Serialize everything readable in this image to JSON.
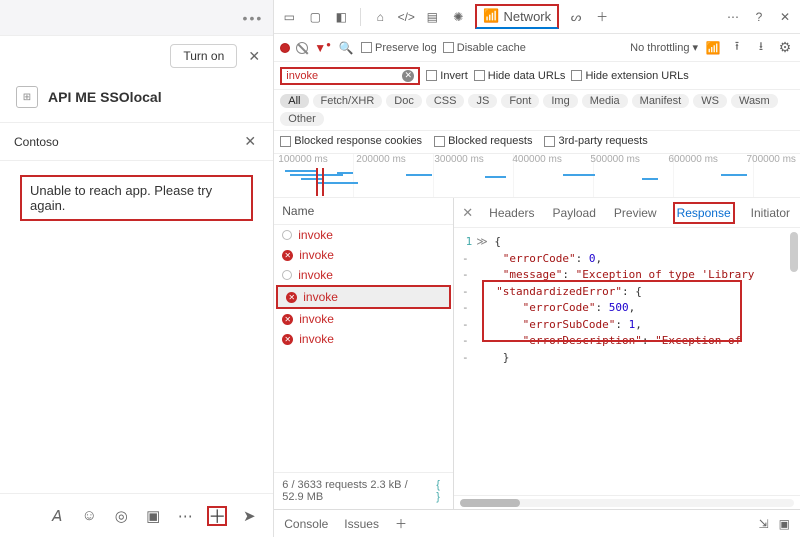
{
  "left": {
    "turn_on": "Turn on",
    "app_title": "API ME SSOlocal",
    "app_icon_glyph": "⊞",
    "card_title": "Contoso",
    "error_message": "Unable to reach app. Please try again."
  },
  "devtools": {
    "tabs": {
      "network_label": "Network"
    },
    "toolbar": {
      "preserve_log": "Preserve log",
      "disable_cache": "Disable cache",
      "throttling": "No throttling"
    },
    "filter": {
      "value": "invoke",
      "invert": "Invert",
      "hide_data_urls": "Hide data URLs",
      "hide_ext_urls": "Hide extension URLs"
    },
    "type_chips": [
      "All",
      "Fetch/XHR",
      "Doc",
      "CSS",
      "JS",
      "Font",
      "Img",
      "Media",
      "Manifest",
      "WS",
      "Wasm",
      "Other"
    ],
    "extra_filters": {
      "blocked_response": "Blocked response cookies",
      "blocked_requests": "Blocked requests",
      "third_party": "3rd-party requests"
    },
    "waterfall_ticks": [
      "100000 ms",
      "200000 ms",
      "300000 ms",
      "400000 ms",
      "500000 ms",
      "600000 ms",
      "700000 ms"
    ],
    "name_header": "Name",
    "requests": [
      {
        "status": "pending",
        "label": "invoke"
      },
      {
        "status": "fail",
        "label": "invoke"
      },
      {
        "status": "pending",
        "label": "invoke"
      },
      {
        "status": "fail",
        "label": "invoke",
        "selected": true,
        "highlight": true
      },
      {
        "status": "fail",
        "label": "invoke"
      },
      {
        "status": "fail",
        "label": "invoke"
      }
    ],
    "summary": "6 / 3633 requests   2.3 kB / 52.9 MB",
    "detail_tabs": [
      "Headers",
      "Payload",
      "Preview",
      "Response",
      "Initiator"
    ],
    "detail_active": "Response",
    "response": {
      "errorCode_outer": 0,
      "message": "\"Exception of type 'Library",
      "std_key": "\"standardizedError\"",
      "errorCode": 500,
      "errorSubCode": 1,
      "errorDescription": "\"Exception of"
    },
    "drawer": {
      "console": "Console",
      "issues": "Issues"
    }
  }
}
